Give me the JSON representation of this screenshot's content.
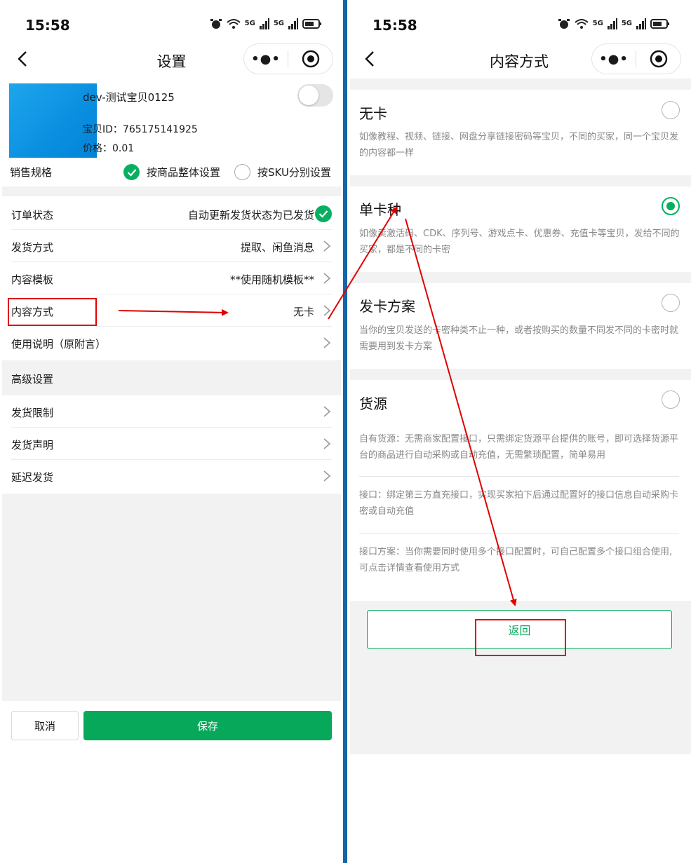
{
  "status": {
    "time": "15:58",
    "net1": "5G",
    "net2": "5G"
  },
  "left": {
    "title": "设置",
    "capsule": {
      "more": "•●•"
    },
    "product": {
      "name": "dev-测试宝贝0125",
      "id": "宝贝ID：765175141925",
      "price": "价格：0.01"
    },
    "spec": {
      "label": "销售规格",
      "option_whole": "按商品整体设置",
      "option_sku": "按SKU分别设置"
    },
    "rows": {
      "order_status": {
        "label": "订单状态",
        "value": "自动更新发货状态为已发货"
      },
      "ship_method": {
        "label": "发货方式",
        "value": "提取、闲鱼消息"
      },
      "template": {
        "label": "内容模板",
        "value": "**使用随机模板**"
      },
      "content_mode": {
        "label": "内容方式",
        "value": "无卡"
      },
      "usage": {
        "label": "使用说明（原附言）"
      },
      "advanced": {
        "label": "高级设置"
      },
      "ship_limit": {
        "label": "发货限制"
      },
      "ship_notice": {
        "label": "发货声明"
      },
      "delay": {
        "label": "延迟发货"
      }
    },
    "buttons": {
      "cancel": "取消",
      "save": "保存"
    }
  },
  "right": {
    "title": "内容方式",
    "options": {
      "none": {
        "title": "无卡",
        "desc": "如像教程、视频、链接、网盘分享链接密码等宝贝，不同的买家，同一个宝贝发的内容都一样"
      },
      "single": {
        "title": "单卡种",
        "desc": "如像卖激活码、CDK、序列号、游戏点卡、优惠券、充值卡等宝贝，发给不同的买家，都是不同的卡密"
      },
      "plan": {
        "title": "发卡方案",
        "desc": "当你的宝贝发送的卡密种类不止一种，或者按购买的数量不同发不同的卡密时就需要用到发卡方案"
      },
      "source": {
        "title": "货源",
        "desc1": "自有货源：无需商家配置接口，只需绑定货源平台提供的账号，即可选择货源平台的商品进行自动采购或自动充值，无需繁琐配置，简单易用",
        "desc2": "接口：绑定第三方直充接口，实现买家拍下后通过配置好的接口信息自动采购卡密或自动充值",
        "desc3": "接口方案：当你需要同时使用多个接口配置时，可自己配置多个接口组合使用,可点击详情查看使用方式"
      }
    },
    "selected": "single",
    "back_button": "返回"
  },
  "colors": {
    "primary_green": "#07a85a",
    "annotation_red": "#e00000",
    "divider_blue": "#1565a8"
  }
}
